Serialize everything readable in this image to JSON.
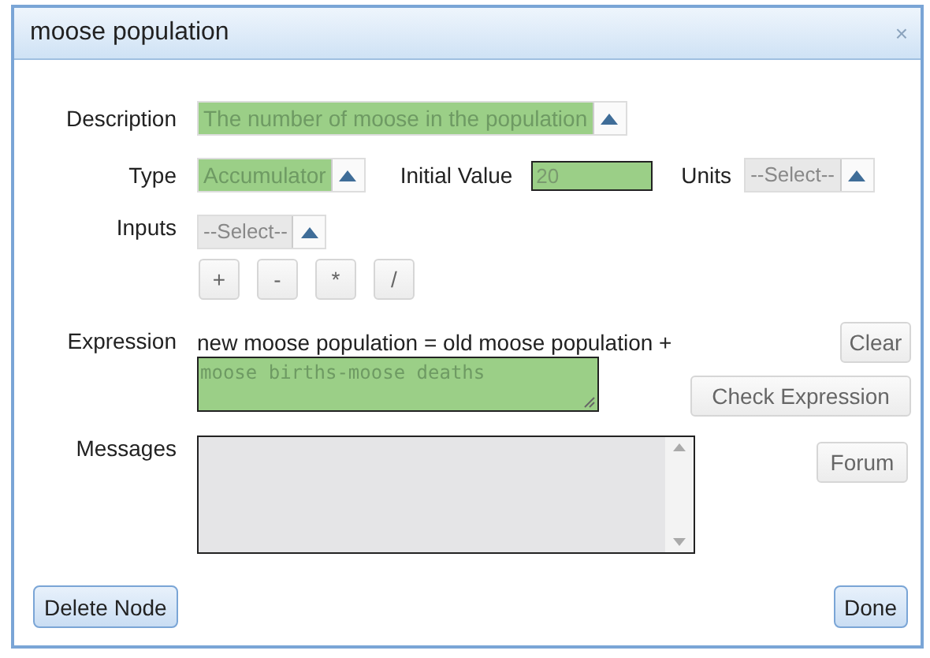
{
  "window": {
    "title": "moose population",
    "close": "×"
  },
  "description": {
    "label": "Description",
    "value": "The number of moose in the population",
    "highlighted": true
  },
  "type": {
    "label": "Type",
    "value": "Accumulator",
    "highlighted": true
  },
  "initial_value": {
    "label": "Initial Value",
    "value": "20",
    "highlighted": true
  },
  "units": {
    "label": "Units",
    "value": "--Select--",
    "highlighted": false
  },
  "inputs": {
    "label": "Inputs",
    "value": "--Select--",
    "highlighted": false
  },
  "operators": [
    "+",
    "-",
    "*",
    "/"
  ],
  "expression": {
    "label": "Expression",
    "prefix": "new moose population = old moose population +",
    "value": "moose births-moose deaths",
    "highlighted": true
  },
  "messages": {
    "label": "Messages"
  },
  "side_buttons": [
    {
      "label": "Clear"
    },
    {
      "label": "Check Expression"
    },
    {
      "label": "Forum"
    }
  ],
  "footer_buttons": [
    {
      "label": "Delete Node"
    },
    {
      "label": "Done"
    }
  ]
}
